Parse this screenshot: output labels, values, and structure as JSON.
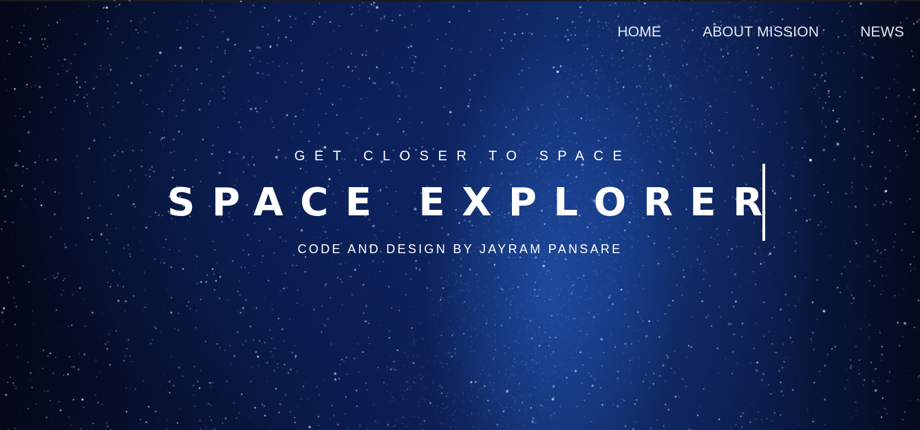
{
  "nav": {
    "items": [
      {
        "label": "HOME"
      },
      {
        "label": "ABOUT MISSION"
      },
      {
        "label": "NEWS"
      }
    ]
  },
  "hero": {
    "tagline": "GET CLOSER TO SPACE",
    "title": "SPACE EXPLORER",
    "byline": "CODE AND DESIGN BY JAYRAM PANSARE"
  },
  "colors": {
    "text": "#ffffff",
    "nav_text": "#e6e8ef",
    "background_dark": "#020615",
    "nebula_blue": "#1e4ba5"
  }
}
